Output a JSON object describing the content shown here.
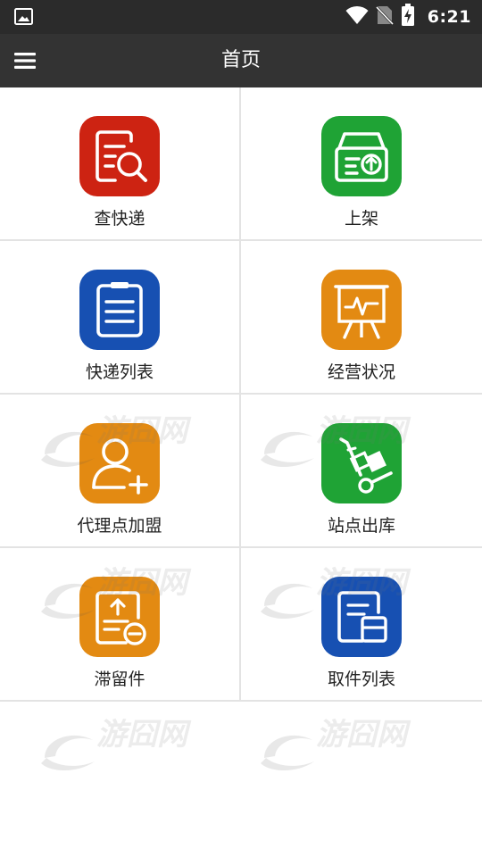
{
  "status_bar": {
    "time": "6:21",
    "icons": [
      "image-icon",
      "wifi-icon",
      "no-sim-icon",
      "battery-charging-icon"
    ]
  },
  "app_bar": {
    "title": "首页",
    "menu_icon": "hamburger-menu-icon"
  },
  "tiles": [
    {
      "label": "查快递",
      "icon": "search-document-icon",
      "color": "#cd2312"
    },
    {
      "label": "上架",
      "icon": "box-upload-icon",
      "color": "#1fa335"
    },
    {
      "label": "快递列表",
      "icon": "clipboard-list-icon",
      "color": "#1750b2"
    },
    {
      "label": "经营状况",
      "icon": "chart-board-icon",
      "color": "#e38a12"
    },
    {
      "label": "代理点加盟",
      "icon": "user-add-icon",
      "color": "#e38a12"
    },
    {
      "label": "站点出库",
      "icon": "hand-truck-icon",
      "color": "#1fa335"
    },
    {
      "label": "滞留件",
      "icon": "document-upload-minus-icon",
      "color": "#e38a12"
    },
    {
      "label": "取件列表",
      "icon": "document-box-icon",
      "color": "#1750b2"
    }
  ],
  "watermark": "游囧网",
  "colors": {
    "status_bar": "#2b2b2b",
    "app_bar": "#333333",
    "divider": "#e3e3e3"
  }
}
